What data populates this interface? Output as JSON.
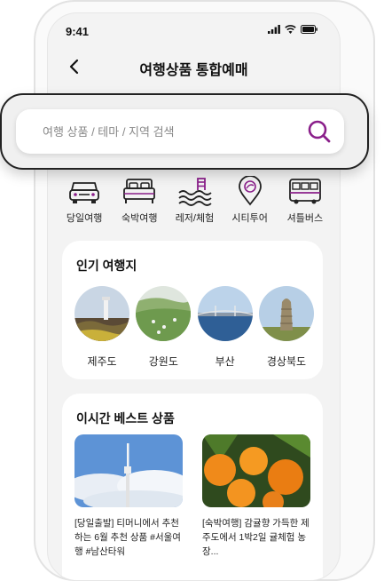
{
  "status_bar": {
    "time": "9:41"
  },
  "header": {
    "title": "여행상품 통합예매"
  },
  "search": {
    "placeholder": "여행 상품 / 테마 / 지역 검색"
  },
  "categories": [
    {
      "label": "당일여행",
      "icon": "car-icon"
    },
    {
      "label": "숙박여행",
      "icon": "bed-icon"
    },
    {
      "label": "레저/체험",
      "icon": "pool-icon"
    },
    {
      "label": "시티투어",
      "icon": "map-pin-icon"
    },
    {
      "label": "셔틀버스",
      "icon": "bus-icon"
    }
  ],
  "popular": {
    "title": "인기 여행지",
    "destinations": [
      {
        "label": "제주도"
      },
      {
        "label": "강원도"
      },
      {
        "label": "부산"
      },
      {
        "label": "경상북도"
      }
    ]
  },
  "best": {
    "title": "이시간 베스트 상품",
    "products": [
      {
        "text": "[당일출발] 티머니에서 추천하는 6월 추천 상품 #서울여행 #남산타워"
      },
      {
        "text": "[숙박여행] 감귤향 가득한 제주도에서 1박2일 귤체험 농장..."
      }
    ]
  },
  "colors": {
    "accent": "#8a1f8a",
    "background": "#f3f3f3"
  }
}
